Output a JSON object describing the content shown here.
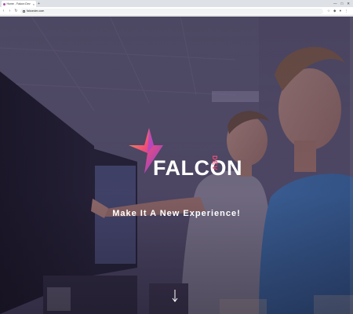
{
  "browser": {
    "tab_title": "Home - Falcon Dev",
    "tab_close": "×",
    "new_tab": "+",
    "window_controls": [
      "—",
      "□",
      "✕"
    ],
    "url": "falcondev.com",
    "nav": {
      "back": "‹",
      "forward": "›",
      "reload": "↻"
    },
    "toolbar_icons": [
      "star-icon",
      "extension-icon",
      "profile-icon",
      "menu-icon"
    ]
  },
  "hero": {
    "brand_word": "FALCON",
    "brand_sub": "DEV",
    "tagline": "Make It A New Experience!",
    "accent_colors": {
      "logo_pink": "#ef4e76",
      "logo_purple": "#7b3fe4",
      "logo_orange": "#f7a04b",
      "overlay": "#3d3550"
    }
  }
}
